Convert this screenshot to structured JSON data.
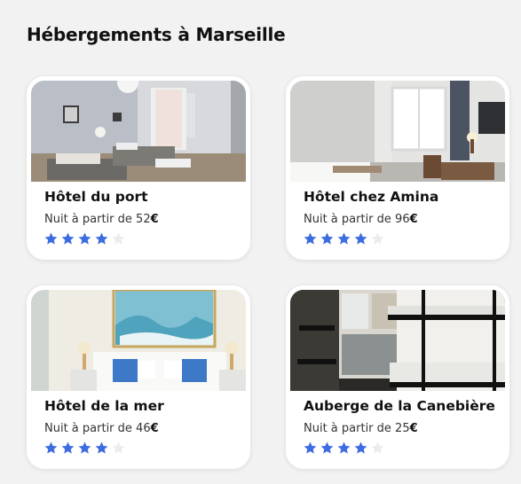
{
  "page": {
    "title": "Hébergements à Marseille"
  },
  "colors": {
    "accent_star": "#3b6ce0",
    "star_empty": "#ececec",
    "card_bg": "#ffffff",
    "page_bg": "#f2f2f2"
  },
  "listings": [
    {
      "name": "Hôtel du port",
      "price_prefix": "Nuit à partir de ",
      "price_value": "52",
      "price_currency": "€",
      "rating": 4,
      "rating_max": 5
    },
    {
      "name": "Hôtel chez Amina",
      "price_prefix": "Nuit à partir de ",
      "price_value": "96",
      "price_currency": "€",
      "rating": 4,
      "rating_max": 5
    },
    {
      "name": "Hôtel de la mer",
      "price_prefix": "Nuit à partir de ",
      "price_value": "46",
      "price_currency": "€",
      "rating": 4,
      "rating_max": 5
    },
    {
      "name": "Auberge de la Canebière",
      "price_prefix": "Nuit à partir de ",
      "price_value": "25",
      "price_currency": "€",
      "rating": 4,
      "rating_max": 5
    }
  ]
}
